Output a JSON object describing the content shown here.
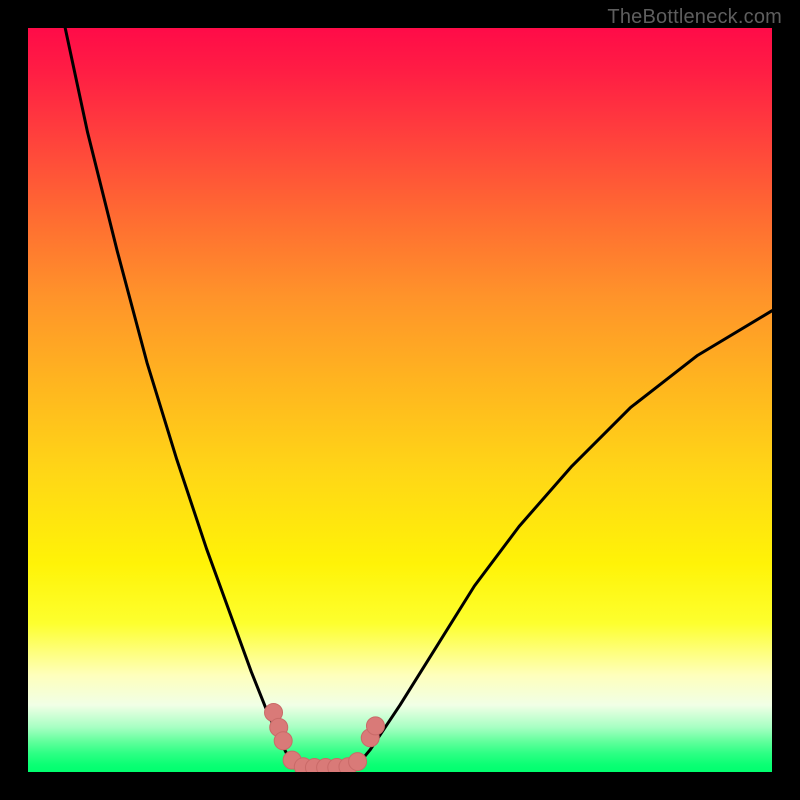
{
  "watermark": "TheBottleneck.com",
  "colors": {
    "frame": "#000000",
    "curve": "#000000",
    "marker_fill": "#d97a78",
    "marker_stroke": "#c96a68"
  },
  "chart_data": {
    "type": "line",
    "title": "",
    "xlabel": "",
    "ylabel": "",
    "xlim": [
      0,
      100
    ],
    "ylim": [
      0,
      100
    ],
    "note": "V-shaped bottleneck curve; y≈0 is optimal (green), y→100 is worst (red).",
    "series": [
      {
        "name": "left-branch",
        "x": [
          5,
          8,
          12,
          16,
          20,
          24,
          28,
          30,
          32,
          33.5,
          35,
          36
        ],
        "y": [
          100,
          86,
          70,
          55,
          42,
          30,
          19,
          13.5,
          8.5,
          5,
          2,
          0.6
        ]
      },
      {
        "name": "right-branch",
        "x": [
          44,
          46,
          50,
          55,
          60,
          66,
          73,
          81,
          90,
          100
        ],
        "y": [
          0.6,
          3,
          9,
          17,
          25,
          33,
          41,
          49,
          56,
          62
        ]
      },
      {
        "name": "valley-floor",
        "x": [
          36,
          38,
          40,
          42,
          44
        ],
        "y": [
          0.6,
          0.3,
          0.3,
          0.3,
          0.6
        ]
      }
    ],
    "markers": [
      {
        "x": 33.0,
        "y": 8.0
      },
      {
        "x": 33.7,
        "y": 6.0
      },
      {
        "x": 34.3,
        "y": 4.2
      },
      {
        "x": 35.5,
        "y": 1.6
      },
      {
        "x": 37.0,
        "y": 0.7
      },
      {
        "x": 38.5,
        "y": 0.6
      },
      {
        "x": 40.0,
        "y": 0.6
      },
      {
        "x": 41.5,
        "y": 0.6
      },
      {
        "x": 43.0,
        "y": 0.7
      },
      {
        "x": 44.3,
        "y": 1.4
      },
      {
        "x": 46.0,
        "y": 4.6
      },
      {
        "x": 46.7,
        "y": 6.2
      }
    ]
  }
}
